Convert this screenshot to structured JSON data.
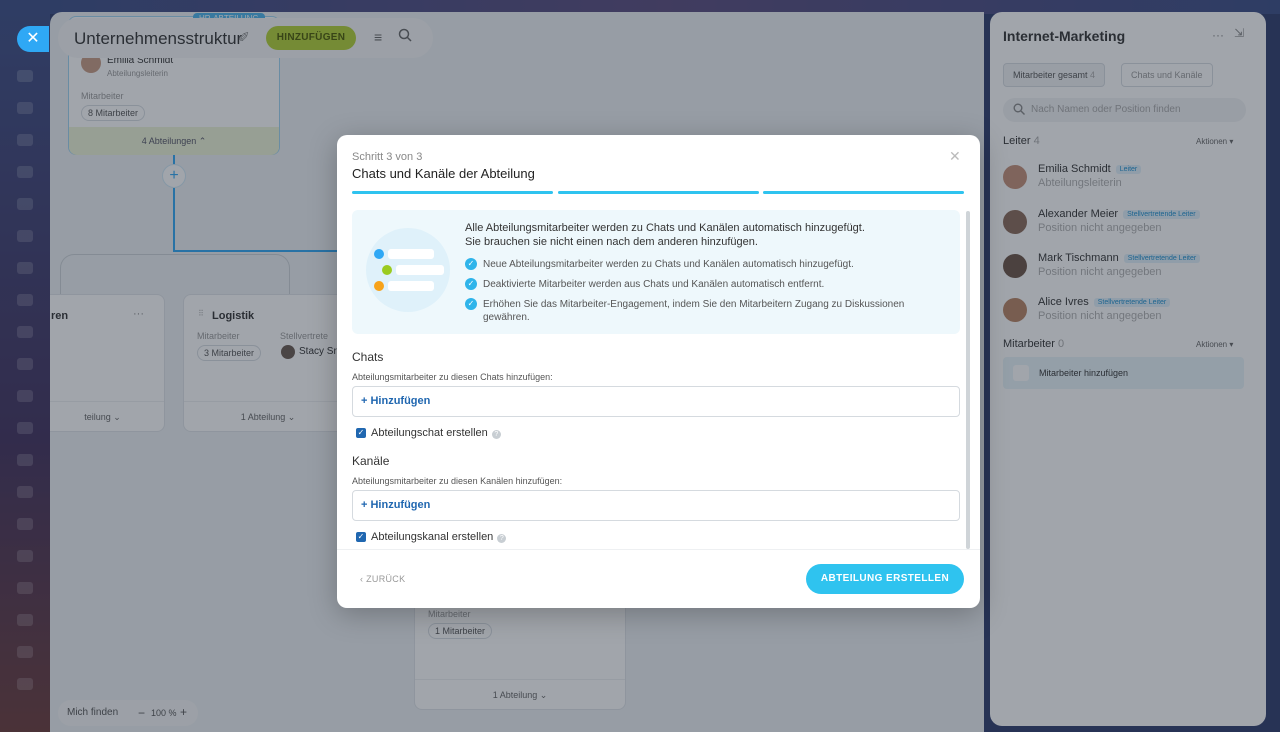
{
  "workspace": {
    "title": "Unternehmensstruktur",
    "add_button": "HINZUFÜGEN",
    "top_card": {
      "badge": "HR-ABTEILUNG",
      "name": "Emilia Schmidt",
      "role": "Abteilungsleiterin",
      "employees_label": "Mitarbeiter",
      "employees_count": "8 Mitarbeiter",
      "departments_toggle": "4 Abteilungen"
    },
    "left_card": {
      "name_fragment": "ren",
      "dept_fragment": "teilung"
    },
    "logistik_card": {
      "name": "Logistik",
      "employees_label": "Mitarbeiter",
      "deputy_label": "Stellvertrete",
      "employees_count": "3 Mitarbeiter",
      "deputy_name": "Stacy Sr",
      "departments_toggle": "1 Abteilung"
    },
    "bottom_card": {
      "employees_label": "Mitarbeiter",
      "employees_count": "1 Mitarbeiter",
      "departments_toggle": "1 Abteilung"
    },
    "bottom_tools": {
      "find_me": "Mich finden",
      "zoom_minus": "−",
      "zoom_value": "100 %",
      "zoom_plus": "+"
    }
  },
  "panel": {
    "title": "Internet-Marketing",
    "tabs": [
      {
        "label": "Mitarbeiter gesamt",
        "count": "4"
      },
      {
        "label": "Chats und Kanäle"
      }
    ],
    "search_placeholder": "Nach Namen oder Position finden",
    "leaders_label": "Leiter",
    "leaders_count": "4",
    "actions_label": "Aktionen",
    "people": [
      {
        "name": "Emilia Schmidt",
        "badge": "Leiter",
        "position": "Abteilungsleiterin"
      },
      {
        "name": "Alexander Meier",
        "badge": "Stellvertretende Leiter",
        "position": "Position nicht angegeben"
      },
      {
        "name": "Mark Tischmann",
        "badge": "Stellvertretende Leiter",
        "position": "Position nicht angegeben"
      },
      {
        "name": "Alice Ivres",
        "badge": "Stellvertretende Leiter",
        "position": "Position nicht angegeben"
      }
    ],
    "employees_label": "Mitarbeiter",
    "employees_count": "0",
    "employees_actions": "Aktionen",
    "add_employee": "Mitarbeiter hinzufügen"
  },
  "modal": {
    "step": "Schritt 3 von 3",
    "title": "Chats und Kanäle der Abteilung",
    "info_line1": "Alle Abteilungsmitarbeiter werden zu Chats und Kanälen automatisch hinzugefügt.",
    "info_line2": "Sie brauchen sie nicht einen nach dem anderen hinzufügen.",
    "bullets": [
      "Neue Abteilungsmitarbeiter werden zu Chats und Kanälen automatisch hinzugefügt.",
      "Deaktivierte Mitarbeiter werden aus Chats und Kanälen automatisch entfernt.",
      "Erhöhen Sie das Mitarbeiter-Engagement, indem Sie den Mitarbeitern Zugang zu Diskussionen gewähren."
    ],
    "chats_heading": "Chats",
    "chats_sub": "Abteilungsmitarbeiter zu diesen Chats hinzufügen:",
    "chats_add": "+ Hinzufügen",
    "chats_checkbox": "Abteilungschat erstellen",
    "channels_heading": "Kanäle",
    "channels_sub": "Abteilungsmitarbeiter zu diesen Kanälen hinzufügen:",
    "channels_add": "+ Hinzufügen",
    "channels_checkbox": "Abteilungskanal erstellen",
    "back_button": "ZURÜCK",
    "create_button": "ABTEILUNG ERSTELLEN"
  },
  "colors": {
    "accent": "#2fc3ef",
    "add_green": "#b4d334",
    "link_blue": "#2067b0"
  }
}
